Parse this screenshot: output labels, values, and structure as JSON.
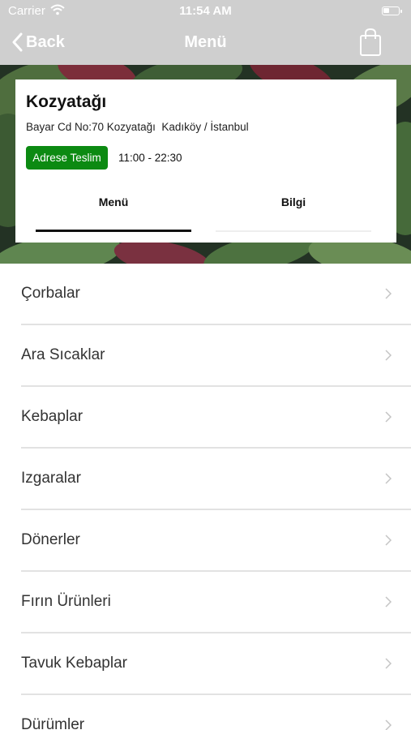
{
  "status_bar": {
    "carrier": "Carrier",
    "time": "11:54 AM"
  },
  "nav": {
    "back_label": "Back",
    "title": "Menü"
  },
  "restaurant": {
    "name": "Kozyatağı",
    "address": "Bayar Cd No:70 Kozyatağı  Kadıköy / İstanbul",
    "delivery_badge": "Adrese Teslim",
    "hours": "11:00 - 22:30"
  },
  "tabs": {
    "menu": "Menü",
    "info": "Bilgi",
    "active": "menu"
  },
  "categories": [
    {
      "label": "Çorbalar"
    },
    {
      "label": "Ara Sıcaklar"
    },
    {
      "label": "Kebaplar"
    },
    {
      "label": "Izgaralar"
    },
    {
      "label": "Dönerler"
    },
    {
      "label": "Fırın Ürünleri"
    },
    {
      "label": "Tavuk Kebaplar"
    },
    {
      "label": "Dürümler"
    }
  ],
  "colors": {
    "topbar": "#cfcfcf",
    "badge": "#0c8a12",
    "separator": "#e2e2e2"
  }
}
